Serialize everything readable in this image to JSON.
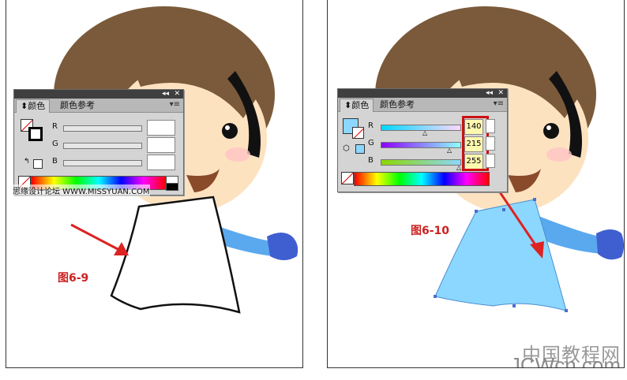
{
  "left": {
    "panel": {
      "tab_active": "颜色",
      "tab_other": "颜色参考",
      "channels": [
        {
          "label": "R",
          "value": ""
        },
        {
          "label": "G",
          "value": ""
        },
        {
          "label": "B",
          "value": ""
        }
      ]
    },
    "caption": "图6-9",
    "watermark": "思缘设计论坛 WWW.MISSYUAN.COM"
  },
  "right": {
    "panel": {
      "tab_active": "颜色",
      "tab_other": "颜色参考",
      "channels": [
        {
          "label": "R",
          "value": "140"
        },
        {
          "label": "G",
          "value": "215"
        },
        {
          "label": "B",
          "value": "255"
        }
      ],
      "fill_color": "#8cd7ff"
    },
    "caption": "图6-10"
  },
  "watermark_site": "中国教程网",
  "watermark_domain": "JCWcn.com",
  "colors": {
    "hair": "#7a5a3a",
    "skin": "#fde2c0",
    "dress_fill": "#8cd7ff",
    "arrow": "#dd2222",
    "sleeve": "#5aa9ee",
    "glove": "#3f5fd0"
  }
}
